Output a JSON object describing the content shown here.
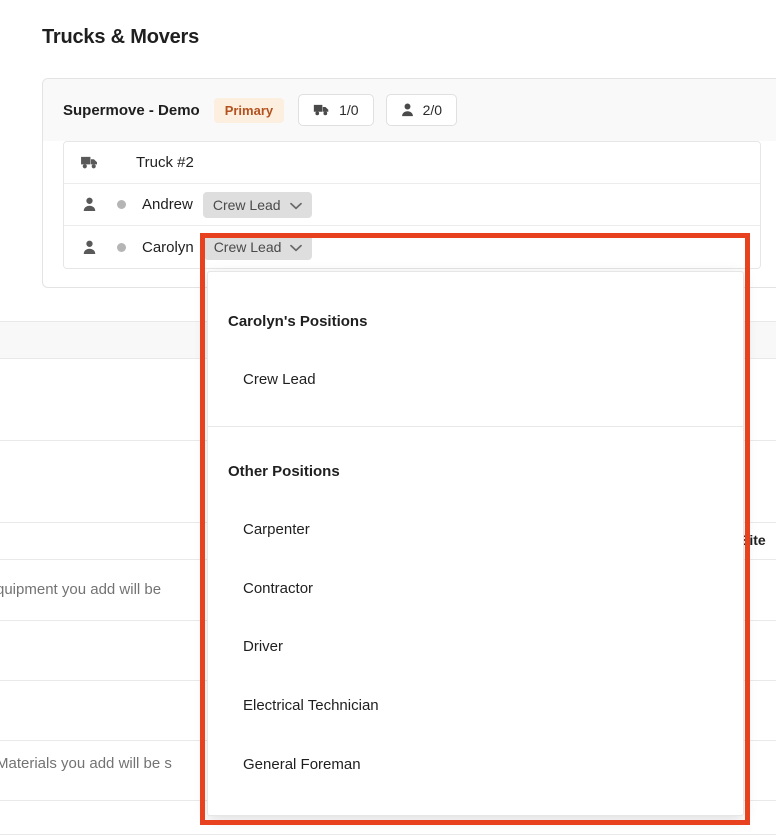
{
  "page": {
    "title": "Trucks & Movers"
  },
  "crew_card": {
    "org_name": "Supermove - Demo",
    "primary_badge": "Primary",
    "truck_count": "1/0",
    "mover_count": "2/0",
    "rows": [
      {
        "type": "truck",
        "label": "Truck #2"
      },
      {
        "type": "mover",
        "label": "Andrew",
        "position": "Crew Lead"
      },
      {
        "type": "mover",
        "label": "Carolyn",
        "position": "Crew Lead"
      }
    ]
  },
  "dropdown": {
    "groups": [
      {
        "title": "Carolyn's Positions",
        "options": [
          "Crew Lead"
        ]
      },
      {
        "title": "Other Positions",
        "options": [
          "Carpenter",
          "Contractor",
          "Driver",
          "Electrical Technician",
          "General Foreman"
        ]
      }
    ]
  },
  "background": {
    "equipment_note": "quipment you add will be",
    "materials_note": "Materials you add will be s",
    "site_header": "Site"
  },
  "colors": {
    "highlight_border": "#e8411f",
    "badge_bg": "#fcefdf",
    "badge_text": "#b4511f",
    "pill_bg": "#dedede"
  }
}
